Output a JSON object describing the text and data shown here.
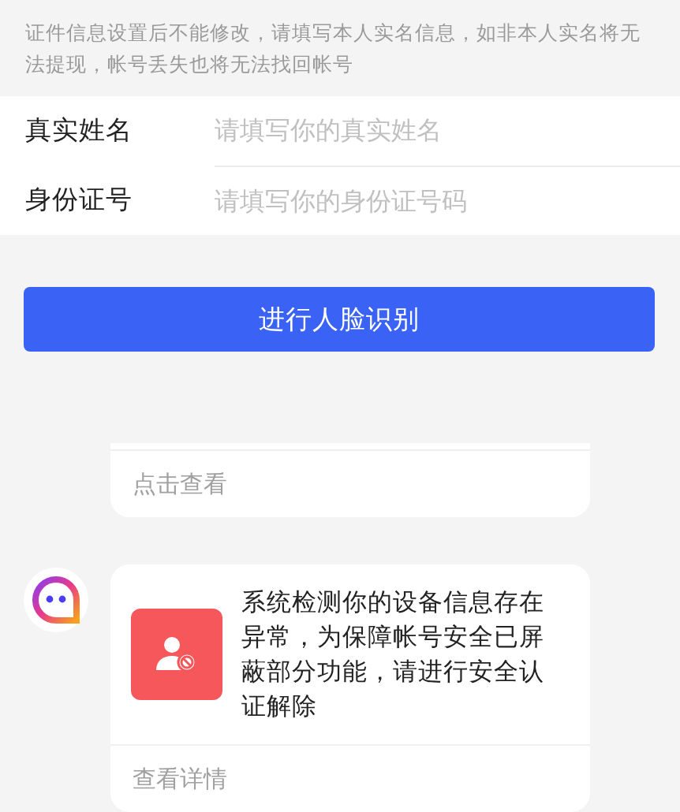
{
  "notice": "证件信息设置后不能修改，请填写本人实名信息，如非本人实名将无法提现，帐号丢失也将无法找回帐号",
  "form": {
    "fields": [
      {
        "label": "真实姓名",
        "placeholder": "请填写你的真实姓名"
      },
      {
        "label": "身份证号",
        "placeholder": "请填写你的身份证号码"
      }
    ]
  },
  "submit_button": "进行人脸识别",
  "messages": [
    {
      "kind": "partial",
      "link": "点击查看"
    },
    {
      "kind": "alert",
      "text": "系统检测你的设备信息存在异常，为保障帐号安全已屏蔽部分功能，请进行安全认证解除",
      "link": "查看详情"
    }
  ]
}
